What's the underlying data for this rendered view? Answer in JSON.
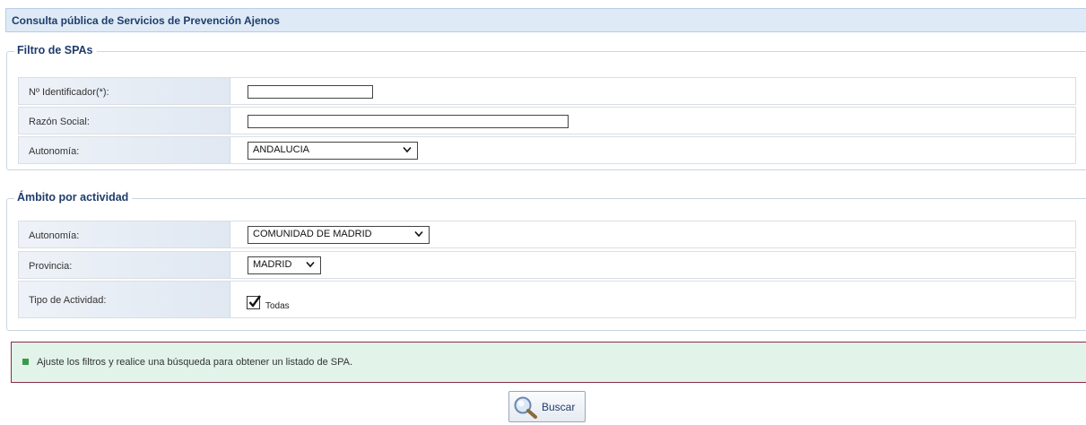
{
  "header": {
    "title": "Consulta pública de Servicios de Prevención Ajenos"
  },
  "filtro": {
    "legend": "Filtro de SPAs",
    "identificador_label": "Nº Identificador(*):",
    "identificador_value": "",
    "razon_label": "Razón Social:",
    "razon_value": "",
    "autonomia_label": "Autonomía:",
    "autonomia_value": "ANDALUCIA"
  },
  "ambito": {
    "legend": "Ámbito por actividad",
    "autonomia_label": "Autonomía:",
    "autonomia_value": "COMUNIDAD DE MADRID",
    "provincia_label": "Provincia:",
    "provincia_value": "MADRID",
    "tipo_label": "Tipo de Actividad:",
    "todas_label": "Todas",
    "todas_checked": true
  },
  "message": {
    "text": "Ajuste los filtros y realice una búsqueda para obtener un listado de SPA."
  },
  "button": {
    "label": "Buscar",
    "icon": "search-icon"
  },
  "colors": {
    "header_bg": "#dfeaf7",
    "title": "#1f3d6b",
    "message_bg": "#e2f3ea",
    "message_border": "#8d2a48",
    "bullet": "#3a9a4a"
  }
}
